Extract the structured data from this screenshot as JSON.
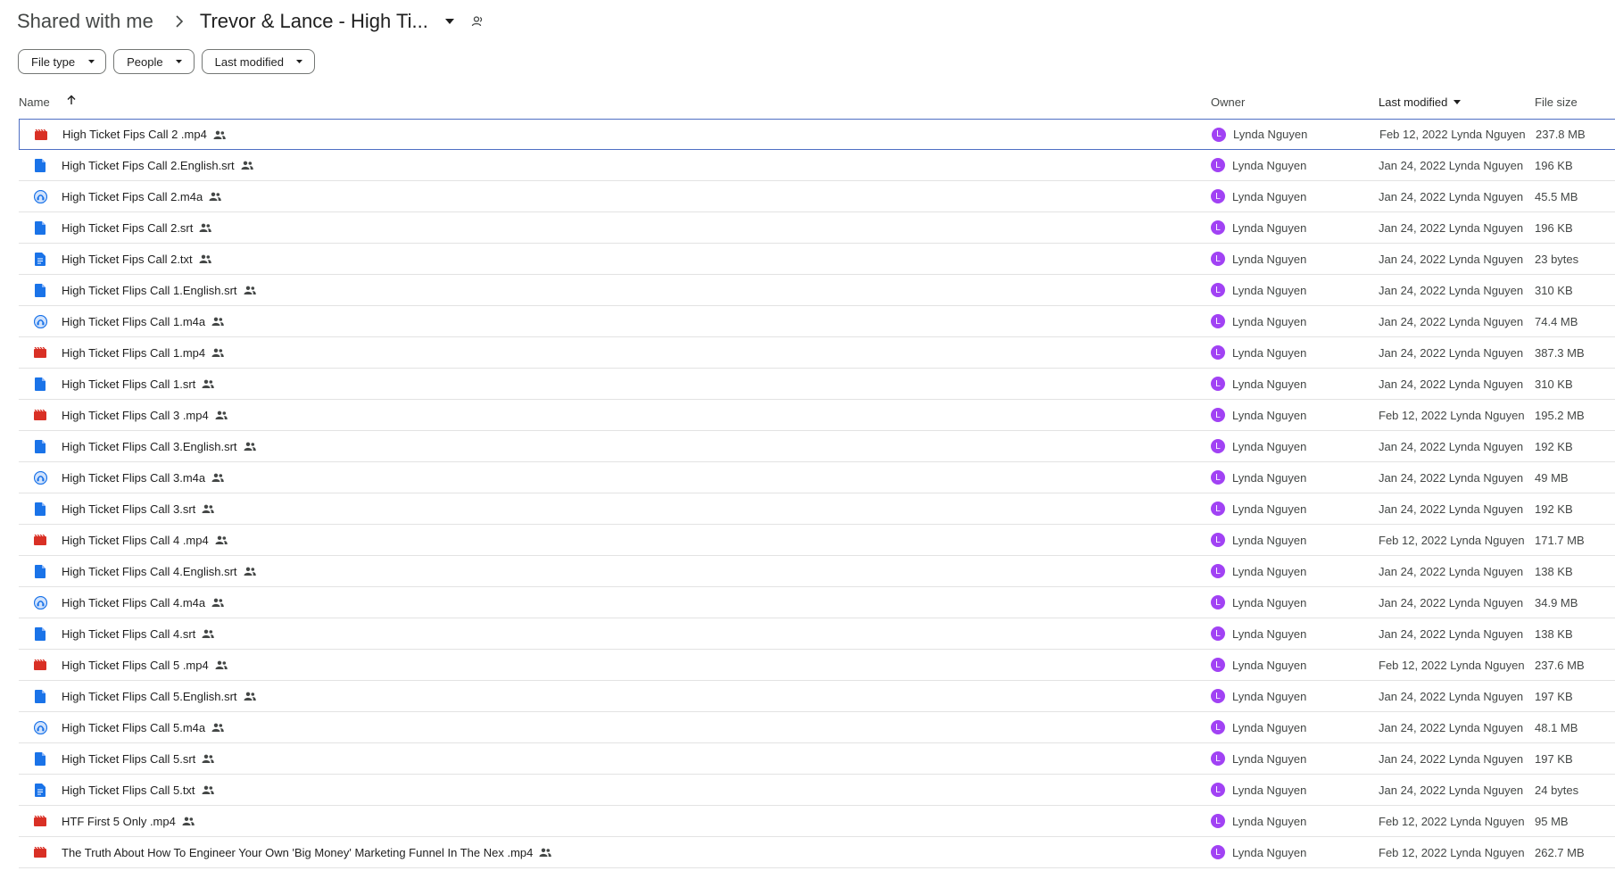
{
  "breadcrumb": {
    "root": "Shared with me",
    "current": "Trevor & Lance - High Ti..."
  },
  "filters": [
    "File type",
    "People",
    "Last modified"
  ],
  "columns": {
    "name": "Name",
    "owner": "Owner",
    "last_modified": "Last modified",
    "file_size": "File size"
  },
  "colors": {
    "video": "#d93025",
    "doc": "#1a73e8",
    "audio": "#1a73e8",
    "avatar": "#a142f4",
    "selected_border": "#4f6fc4"
  },
  "files": [
    {
      "name": "High Ticket Fips Call 2 .mp4",
      "type": "video",
      "owner": "Lynda Nguyen",
      "owner_initial": "L",
      "modified": "Feb 12, 2022 Lynda Nguyen",
      "size": "237.8 MB"
    },
    {
      "name": "High Ticket Fips Call 2.English.srt",
      "type": "doc",
      "owner": "Lynda Nguyen",
      "owner_initial": "L",
      "modified": "Jan 24, 2022 Lynda Nguyen",
      "size": "196 KB"
    },
    {
      "name": "High Ticket Fips Call 2.m4a",
      "type": "audio",
      "owner": "Lynda Nguyen",
      "owner_initial": "L",
      "modified": "Jan 24, 2022 Lynda Nguyen",
      "size": "45.5 MB"
    },
    {
      "name": "High Ticket Fips Call 2.srt",
      "type": "doc",
      "owner": "Lynda Nguyen",
      "owner_initial": "L",
      "modified": "Jan 24, 2022 Lynda Nguyen",
      "size": "196 KB"
    },
    {
      "name": "High Ticket Fips Call 2.txt",
      "type": "text",
      "owner": "Lynda Nguyen",
      "owner_initial": "L",
      "modified": "Jan 24, 2022 Lynda Nguyen",
      "size": "23 bytes"
    },
    {
      "name": "High Ticket Flips Call 1.English.srt",
      "type": "doc",
      "owner": "Lynda Nguyen",
      "owner_initial": "L",
      "modified": "Jan 24, 2022 Lynda Nguyen",
      "size": "310 KB"
    },
    {
      "name": "High Ticket Flips Call 1.m4a",
      "type": "audio",
      "owner": "Lynda Nguyen",
      "owner_initial": "L",
      "modified": "Jan 24, 2022 Lynda Nguyen",
      "size": "74.4 MB"
    },
    {
      "name": "High Ticket Flips Call 1.mp4",
      "type": "video",
      "owner": "Lynda Nguyen",
      "owner_initial": "L",
      "modified": "Jan 24, 2022 Lynda Nguyen",
      "size": "387.3 MB"
    },
    {
      "name": "High Ticket Flips Call 1.srt",
      "type": "doc",
      "owner": "Lynda Nguyen",
      "owner_initial": "L",
      "modified": "Jan 24, 2022 Lynda Nguyen",
      "size": "310 KB"
    },
    {
      "name": "High Ticket Flips Call 3 .mp4",
      "type": "video",
      "owner": "Lynda Nguyen",
      "owner_initial": "L",
      "modified": "Feb 12, 2022 Lynda Nguyen",
      "size": "195.2 MB"
    },
    {
      "name": "High Ticket Flips Call 3.English.srt",
      "type": "doc",
      "owner": "Lynda Nguyen",
      "owner_initial": "L",
      "modified": "Jan 24, 2022 Lynda Nguyen",
      "size": "192 KB"
    },
    {
      "name": "High Ticket Flips Call 3.m4a",
      "type": "audio",
      "owner": "Lynda Nguyen",
      "owner_initial": "L",
      "modified": "Jan 24, 2022 Lynda Nguyen",
      "size": "49 MB"
    },
    {
      "name": "High Ticket Flips Call 3.srt",
      "type": "doc",
      "owner": "Lynda Nguyen",
      "owner_initial": "L",
      "modified": "Jan 24, 2022 Lynda Nguyen",
      "size": "192 KB"
    },
    {
      "name": "High Ticket Flips Call 4 .mp4",
      "type": "video",
      "owner": "Lynda Nguyen",
      "owner_initial": "L",
      "modified": "Feb 12, 2022 Lynda Nguyen",
      "size": "171.7 MB"
    },
    {
      "name": "High Ticket Flips Call 4.English.srt",
      "type": "doc",
      "owner": "Lynda Nguyen",
      "owner_initial": "L",
      "modified": "Jan 24, 2022 Lynda Nguyen",
      "size": "138 KB"
    },
    {
      "name": "High Ticket Flips Call 4.m4a",
      "type": "audio",
      "owner": "Lynda Nguyen",
      "owner_initial": "L",
      "modified": "Jan 24, 2022 Lynda Nguyen",
      "size": "34.9 MB"
    },
    {
      "name": "High Ticket Flips Call 4.srt",
      "type": "doc",
      "owner": "Lynda Nguyen",
      "owner_initial": "L",
      "modified": "Jan 24, 2022 Lynda Nguyen",
      "size": "138 KB"
    },
    {
      "name": "High Ticket Flips Call 5 .mp4",
      "type": "video",
      "owner": "Lynda Nguyen",
      "owner_initial": "L",
      "modified": "Feb 12, 2022 Lynda Nguyen",
      "size": "237.6 MB"
    },
    {
      "name": "High Ticket Flips Call 5.English.srt",
      "type": "doc",
      "owner": "Lynda Nguyen",
      "owner_initial": "L",
      "modified": "Jan 24, 2022 Lynda Nguyen",
      "size": "197 KB"
    },
    {
      "name": "High Ticket Flips Call 5.m4a",
      "type": "audio",
      "owner": "Lynda Nguyen",
      "owner_initial": "L",
      "modified": "Jan 24, 2022 Lynda Nguyen",
      "size": "48.1 MB"
    },
    {
      "name": "High Ticket Flips Call 5.srt",
      "type": "doc",
      "owner": "Lynda Nguyen",
      "owner_initial": "L",
      "modified": "Jan 24, 2022 Lynda Nguyen",
      "size": "197 KB"
    },
    {
      "name": "High Ticket Flips Call 5.txt",
      "type": "text",
      "owner": "Lynda Nguyen",
      "owner_initial": "L",
      "modified": "Jan 24, 2022 Lynda Nguyen",
      "size": "24 bytes"
    },
    {
      "name": "HTF First 5 Only .mp4",
      "type": "video",
      "owner": "Lynda Nguyen",
      "owner_initial": "L",
      "modified": "Feb 12, 2022 Lynda Nguyen",
      "size": "95 MB"
    },
    {
      "name": "The Truth About How To Engineer Your Own 'Big Money' Marketing Funnel In The Nex .mp4",
      "type": "video",
      "owner": "Lynda Nguyen",
      "owner_initial": "L",
      "modified": "Feb 12, 2022 Lynda Nguyen",
      "size": "262.7 MB"
    }
  ]
}
